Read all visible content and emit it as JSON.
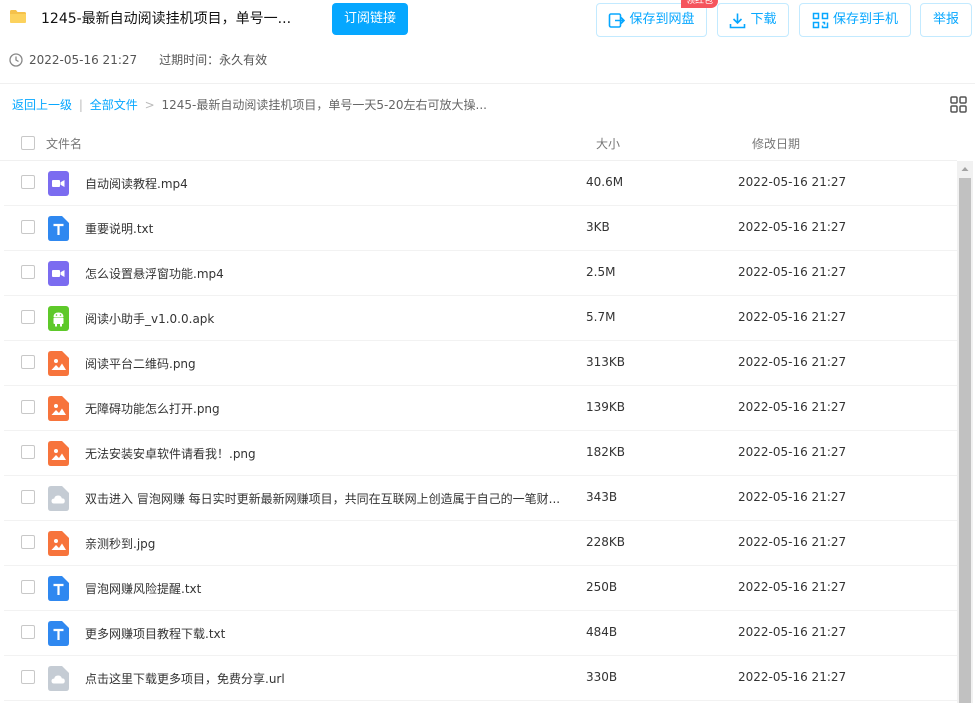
{
  "header": {
    "title": "1245-最新自动阅读挂机项目，单号一...",
    "subscribe_label": "订阅链接",
    "save_to_disk_label": "保存到网盘",
    "save_badge": "领红包",
    "download_label": "下载",
    "save_to_phone_label": "保存到手机",
    "report_label": "举报",
    "created": "2022-05-16 21:27",
    "expiry": "过期时间：永久有效"
  },
  "breadcrumb": {
    "back": "返回上一级",
    "divider": "|",
    "all_files": "全部文件",
    "separator": ">",
    "current": "1245-最新自动阅读挂机项目，单号一天5-20左右可放大操..."
  },
  "columns": {
    "name": "文件名",
    "size": "大小",
    "date": "修改日期"
  },
  "colors": {
    "accent": "#06a7ff",
    "video": "#7b6cf0",
    "text": "#2f88f0",
    "apk": "#5ec92a",
    "image": "#f7743c",
    "link": "#c5ccd4",
    "badge": "#f5545d"
  },
  "files": [
    {
      "name": "自动阅读教程.mp4",
      "size": "40.6M",
      "date": "2022-05-16 21:27",
      "icon": "video-file-icon"
    },
    {
      "name": "重要说明.txt",
      "size": "3KB",
      "date": "2022-05-16 21:27",
      "icon": "text-file-icon"
    },
    {
      "name": "怎么设置悬浮窗功能.mp4",
      "size": "2.5M",
      "date": "2022-05-16 21:27",
      "icon": "video-file-icon"
    },
    {
      "name": "阅读小助手_v1.0.0.apk",
      "size": "5.7M",
      "date": "2022-05-16 21:27",
      "icon": "android-file-icon"
    },
    {
      "name": "阅读平台二维码.png",
      "size": "313KB",
      "date": "2022-05-16 21:27",
      "icon": "image-file-icon"
    },
    {
      "name": "无障碍功能怎么打开.png",
      "size": "139KB",
      "date": "2022-05-16 21:27",
      "icon": "image-file-icon"
    },
    {
      "name": "无法安装安卓软件请看我！.png",
      "size": "182KB",
      "date": "2022-05-16 21:27",
      "icon": "image-file-icon"
    },
    {
      "name": "双击进入 冒泡网赚 每日实时更新最新网赚项目，共同在互联网上创造属于自己的一笔财...",
      "size": "343B",
      "date": "2022-05-16 21:27",
      "icon": "link-file-icon"
    },
    {
      "name": "亲测秒到.jpg",
      "size": "228KB",
      "date": "2022-05-16 21:27",
      "icon": "image-file-icon"
    },
    {
      "name": "冒泡网赚风险提醒.txt",
      "size": "250B",
      "date": "2022-05-16 21:27",
      "icon": "text-file-icon"
    },
    {
      "name": "更多网赚项目教程下载.txt",
      "size": "484B",
      "date": "2022-05-16 21:27",
      "icon": "text-file-icon"
    },
    {
      "name": "点击这里下载更多项目，免费分享.url",
      "size": "330B",
      "date": "2022-05-16 21:27",
      "icon": "link-file-icon"
    }
  ]
}
